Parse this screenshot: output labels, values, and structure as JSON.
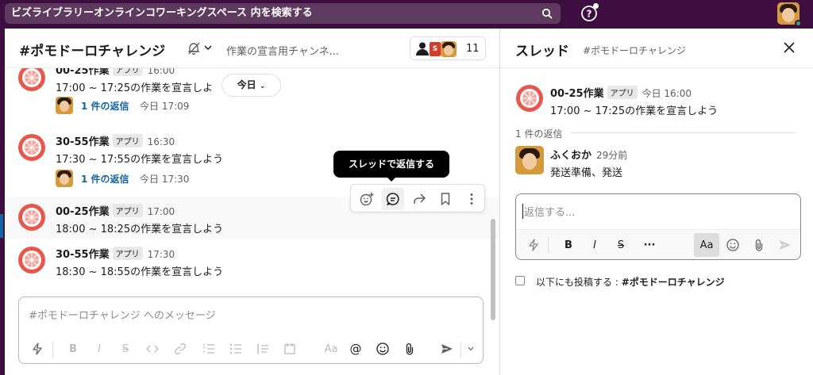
{
  "topbar": {
    "search_text": "ビズライブラリーオンラインコワーキングスペース 内を検索する",
    "brand_color": "#3f0e40"
  },
  "channel": {
    "title": "#ポモドーロチャレンジ",
    "topic": "作業の宣言用チャンネ...",
    "member_s": "S",
    "member_count": "11",
    "today_label": "今日",
    "messages": [
      {
        "name": "00-25作業",
        "badge": "アプリ",
        "time": "16:00",
        "text": "17:00 ~ 17:25の作業を宣言しよ",
        "reply_label": "1 件の返信",
        "reply_time": "今日 17:09"
      },
      {
        "name": "30-55作業",
        "badge": "アプリ",
        "time": "16:30",
        "text": "17:30 ~ 17:55の作業を宣言しよう",
        "reply_label": "1 件の返信",
        "reply_time": "今日 17:30"
      },
      {
        "name": "00-25作業",
        "badge": "アプリ",
        "time": "17:00",
        "text": "18:00 ~ 18:25の作業を宣言しよう"
      },
      {
        "name": "30-55作業",
        "badge": "アプリ",
        "time": "17:30",
        "text": "18:30 ~ 18:55の作業を宣言しよう"
      }
    ],
    "tooltip": "スレッドで返信する",
    "composer_placeholder": "#ポモドーロチャレンジ へのメッセージ",
    "toolbar": {
      "bold": "B",
      "italic": "I",
      "strike": "S",
      "format": "Aa",
      "mention": "@"
    }
  },
  "thread": {
    "title": "スレッド",
    "subtitle": "#ポモドーロチャレンジ",
    "parent": {
      "name": "00-25作業",
      "badge": "アプリ",
      "time": "今日 16:00",
      "text": "17:00 ~ 17:25の作業を宣言しよう"
    },
    "reply_count": "1 件の返信",
    "reply": {
      "name": "ふくおか",
      "time": "29分前",
      "text": "発送準備、発送"
    },
    "composer_placeholder": "返信する...",
    "toolbar": {
      "bold": "B",
      "italic": "I",
      "strike": "S",
      "more": "···",
      "format": "Aa"
    },
    "also_post_prefix": "以下にも投稿する : ",
    "also_post_channel": "#ポモドーロチャレンジ"
  },
  "colors": {
    "accent": "#1264a3",
    "app_icon": "#e8574c",
    "status_online": "#2bac76"
  }
}
